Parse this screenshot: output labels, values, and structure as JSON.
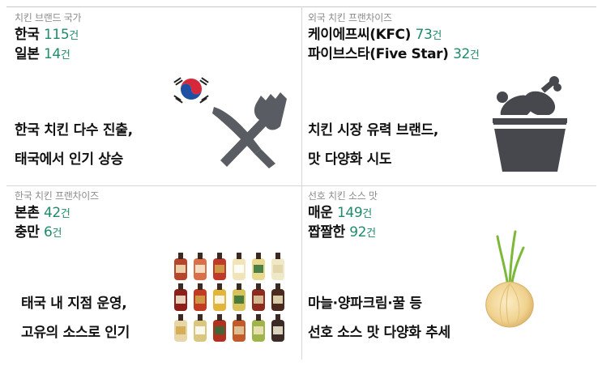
{
  "panels": [
    {
      "category": "치킨 브랜드 국가",
      "stats": [
        {
          "label": "한국",
          "value": "115",
          "unit": "건"
        },
        {
          "label": "일본",
          "value": "14",
          "unit": "건"
        }
      ],
      "desc": [
        "한국 치킨 다수 진출,",
        "태국에서 인기 상승"
      ],
      "icon": "korean-flag-and-utensils"
    },
    {
      "category": "외국 치킨 프랜차이즈",
      "stats": [
        {
          "label": "케이에프씨(KFC)",
          "value": "73",
          "unit": "건"
        },
        {
          "label": "파이브스타(Five Star)",
          "value": "32",
          "unit": "건"
        }
      ],
      "desc": [
        "치킨 시장 유력 브랜드,",
        "맛 다양화 시도"
      ],
      "icon": "chicken-bucket"
    },
    {
      "category": "한국 치킨 프랜차이즈",
      "stats": [
        {
          "label": "본촌",
          "value": "42",
          "unit": "건"
        },
        {
          "label": "충만",
          "value": "6",
          "unit": "건"
        }
      ],
      "desc": [
        "태국 내 지점 운영,",
        "고유의 소스로 인기"
      ],
      "icon": "sauce-bottles"
    },
    {
      "category": "선호 치킨 소스 맛",
      "stats": [
        {
          "label": "매운",
          "value": "149",
          "unit": "건"
        },
        {
          "label": "짭짤한",
          "value": "92",
          "unit": "건"
        }
      ],
      "desc": [
        "마늘·양파크림·꿀 등",
        "선호 소스 맛 다양화 추세"
      ],
      "icon": "onion"
    }
  ],
  "colors": {
    "accent": "#1f8b6a",
    "category": "#8c8c8c",
    "divider": "#d6d6d6"
  }
}
